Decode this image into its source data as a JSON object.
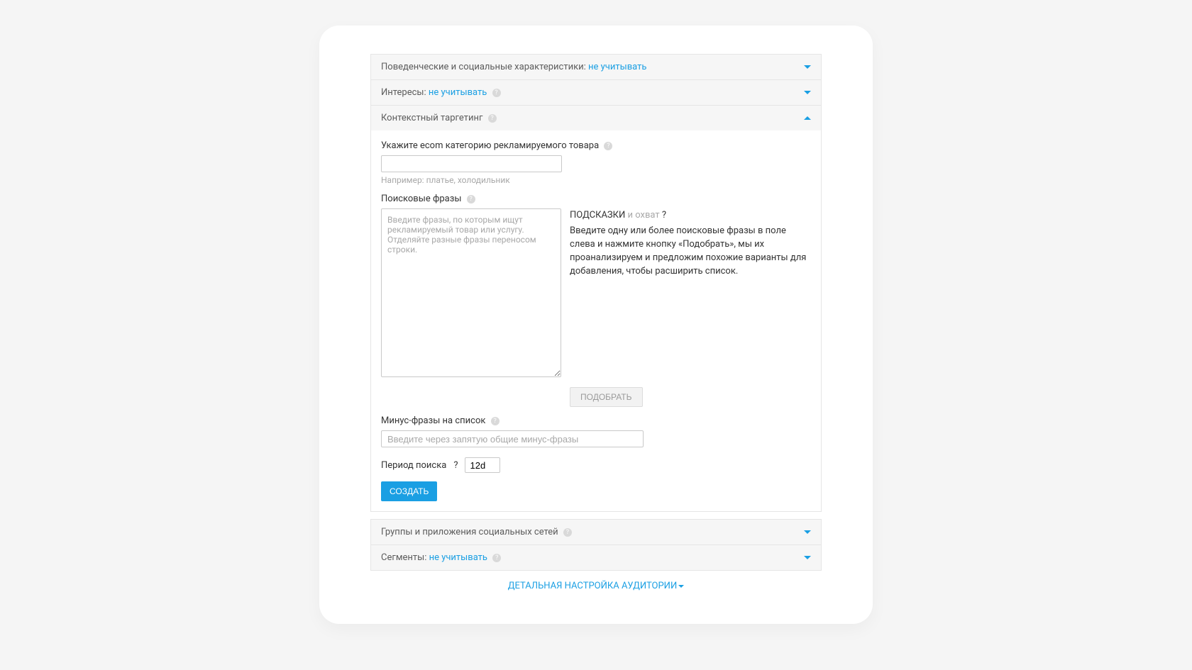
{
  "sections": {
    "behavioral": {
      "label": "Поведенческие и социальные характеристики:",
      "value": "не учитывать"
    },
    "interests": {
      "label": "Интересы:",
      "value": "не учитывать"
    },
    "contextual": {
      "label": "Контекстный таргетинг"
    },
    "groups": {
      "label": "Группы и приложения социальных сетей"
    },
    "segments": {
      "label": "Сегменты:",
      "value": "не учитывать"
    }
  },
  "ecom": {
    "label": "Укажите ecom категорию рекламируемого товара",
    "value": "",
    "hint": "Например: платье, холодильник"
  },
  "phrases": {
    "label": "Поисковые фразы",
    "value": "",
    "placeholder": "Введите фразы, по которым ищут рекламируемый товар или услугу. Отделяйте разные фразы переносом строки."
  },
  "hints": {
    "title": "ПОДСКАЗКИ",
    "subtitle": "и охват",
    "body": "Введите одну или более поисковые фразы в поле слева и нажмите кнопку «Подобрать», мы их проанализируем и предложим похожие варианты для добавления, чтобы расширить список.",
    "pick_btn": "ПОДОБРАТЬ"
  },
  "minus": {
    "label": "Минус-фразы на список",
    "placeholder": "Введите через запятую общие минус-фразы",
    "value": ""
  },
  "period": {
    "label": "Период поиска",
    "value": "12d"
  },
  "create_btn": "СОЗДАТЬ",
  "detail_link": "ДЕТАЛЬНАЯ НАСТРОЙКА АУДИТОРИИ"
}
